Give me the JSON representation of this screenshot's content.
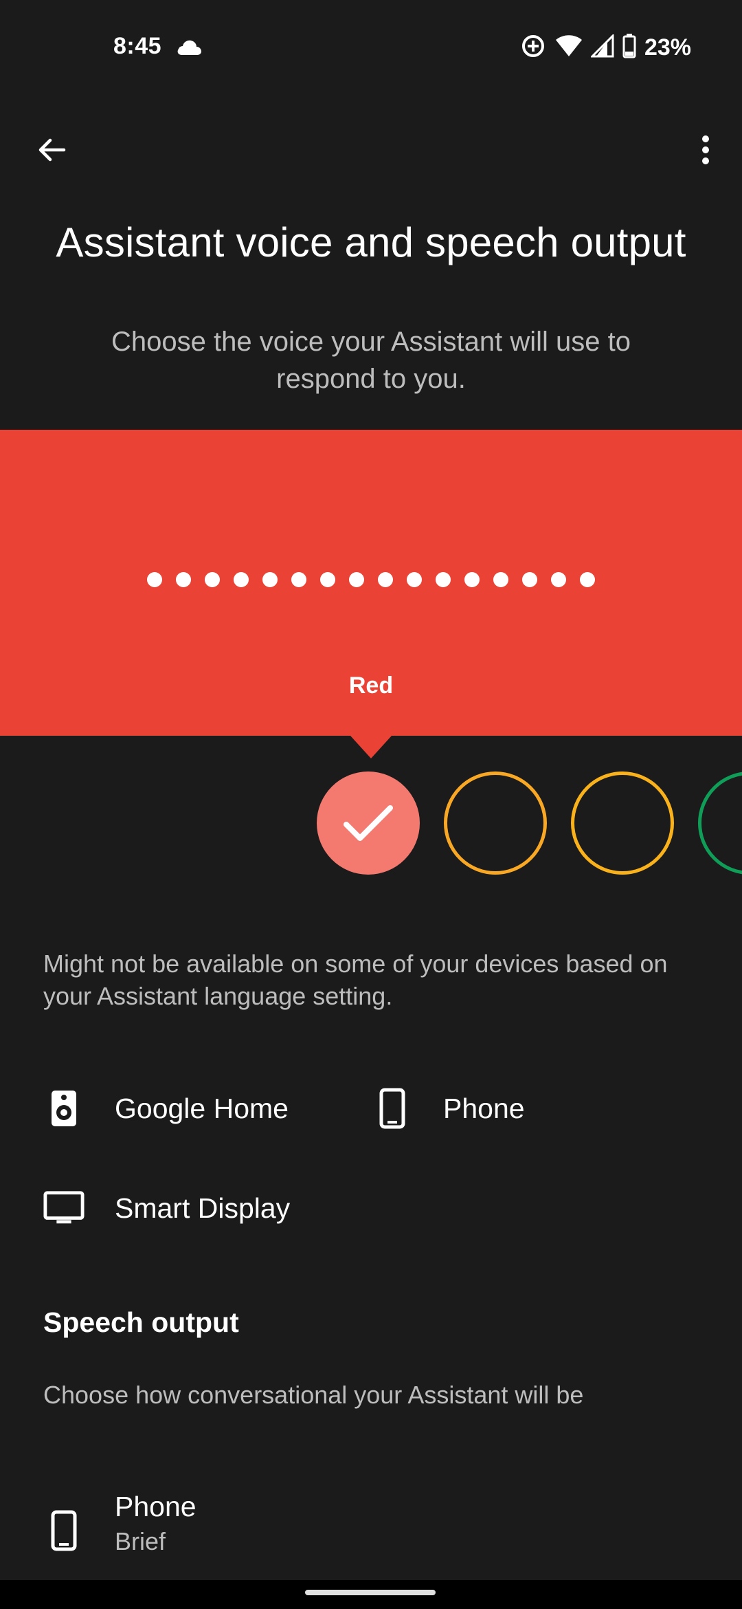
{
  "status_bar": {
    "time": "8:45",
    "battery": "23%",
    "icons": [
      "cloud-icon",
      "assistant-status-icon",
      "wifi-icon",
      "signal-icon",
      "battery-icon"
    ]
  },
  "app_bar": {
    "back_icon": "arrow-back-icon",
    "more_icon": "more-vert-icon"
  },
  "header": {
    "title": "Assistant voice and speech output",
    "subtitle": "Choose the voice your Assistant will use to respond to you."
  },
  "voice_banner": {
    "color": "#ea4335",
    "selected_voice": "Red",
    "dot_count": 16
  },
  "voice_options": [
    {
      "name": "red",
      "color": "#f47a70",
      "selected": true
    },
    {
      "name": "orange",
      "color": "#f9a825",
      "selected": false
    },
    {
      "name": "orange-2",
      "color": "#f9b21b",
      "selected": false
    },
    {
      "name": "green",
      "color": "#0f9d58",
      "selected": false
    }
  ],
  "availability_note": "Might not be available on some of your devices based on your Assistant language setting.",
  "devices": [
    {
      "label": "Google Home",
      "icon": "speaker-icon"
    },
    {
      "label": "Phone",
      "icon": "phone-icon"
    },
    {
      "label": "Smart Display",
      "icon": "display-icon"
    }
  ],
  "speech_output": {
    "heading": "Speech output",
    "description": "Choose how conversational your Assistant will be",
    "items": [
      {
        "title": "Phone",
        "value": "Brief",
        "icon": "phone-icon"
      }
    ]
  }
}
